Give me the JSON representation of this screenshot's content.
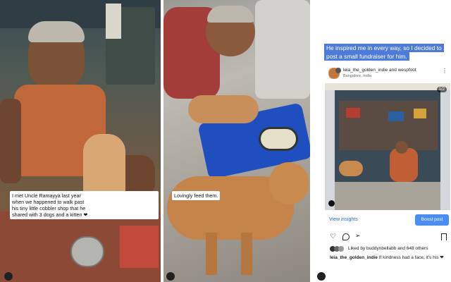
{
  "panel1": {
    "caption_lines": [
      "I met Uncle Ramayya last year",
      "when we happened to walk past",
      "his tiny little cobbler shop that he",
      "shared with 3 dogs and a kitten ❤"
    ]
  },
  "panel2": {
    "caption": "Lovingly feed them."
  },
  "panel3": {
    "intro_lines": [
      "He inspired me in every way, so I decided to",
      "post a small fundraiser for him."
    ],
    "post": {
      "author_line": "leia_the_golden_indie and wespfoot",
      "location": "Bangalore, India",
      "image_counter": "1/2",
      "view_insights": "View insights",
      "boost_button": "Boost post",
      "liked_by": "Liked by buddynbellabb and 648 others",
      "caption_user": "leia_the_golden_indie",
      "caption_text": "If kindness had a face, it's his ❤"
    }
  }
}
